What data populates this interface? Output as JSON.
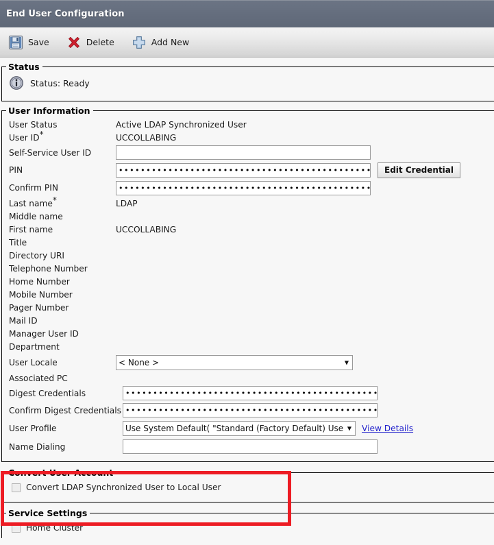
{
  "window": {
    "title": "End User Configuration",
    "header_bg": "#646d7d"
  },
  "toolbar": {
    "save_label": "Save",
    "delete_label": "Delete",
    "add_new_label": "Add New"
  },
  "status": {
    "legend": "Status",
    "text": "Status: Ready",
    "icon": "info-icon"
  },
  "user_information": {
    "legend": "User Information",
    "fields": {
      "user_status": {
        "label": "User Status",
        "value": "Active LDAP Synchronized User"
      },
      "user_id": {
        "label": "User ID",
        "required": "*",
        "value": "UCCOLLABING"
      },
      "self_service_user_id": {
        "label": "Self-Service User ID",
        "value": "",
        "placeholder": ""
      },
      "pin": {
        "label": "PIN",
        "value": "••••••••••••••••••••••••••••••••••••••••••••••••••••••••"
      },
      "confirm_pin": {
        "label": "Confirm PIN",
        "value": "••••••••••••••••••••••••••••••••••••••••••••••••••••••••"
      },
      "edit_credential_label": "Edit Credential",
      "last_name": {
        "label": "Last name",
        "required": "*",
        "value": "LDAP"
      },
      "middle_name": {
        "label": "Middle name",
        "value": ""
      },
      "first_name": {
        "label": "First name",
        "value": "UCCOLLABING"
      },
      "title": {
        "label": "Title",
        "value": ""
      },
      "directory_uri": {
        "label": "Directory URI",
        "value": ""
      },
      "telephone_number": {
        "label": "Telephone Number",
        "value": ""
      },
      "home_number": {
        "label": "Home Number",
        "value": ""
      },
      "mobile_number": {
        "label": "Mobile Number",
        "value": ""
      },
      "pager_number": {
        "label": "Pager Number",
        "value": ""
      },
      "mail_id": {
        "label": "Mail ID",
        "value": ""
      },
      "manager_user_id": {
        "label": "Manager User ID",
        "value": ""
      },
      "department": {
        "label": "Department",
        "value": ""
      },
      "user_locale": {
        "label": "User Locale",
        "selected": "< None >"
      },
      "associated_pc": {
        "label": "Associated PC",
        "value": ""
      },
      "digest_credentials": {
        "label": "Digest Credentials",
        "value": "••••••••••••••••••••••••••••••••••••••••••••••••••••••••"
      },
      "confirm_digest_credentials": {
        "label": "Confirm Digest Credentials",
        "value": "••••••••••••••••••••••••••••••••••••••••••••••••••••••••"
      },
      "user_profile": {
        "label": "User Profile",
        "selected": "Use System Default( \"Standard (Factory Default) Use",
        "view_details_label": "View Details"
      },
      "name_dialing": {
        "label": "Name Dialing",
        "value": ""
      }
    }
  },
  "convert_user_account": {
    "legend": "Convert User Account",
    "checkbox_label": "Convert LDAP Synchronized User to Local User",
    "checked": false,
    "highlight_color": "#ed1c24"
  },
  "service_settings": {
    "legend": "Service Settings",
    "home_cluster_label": "Home Cluster",
    "home_cluster_checked": false
  }
}
